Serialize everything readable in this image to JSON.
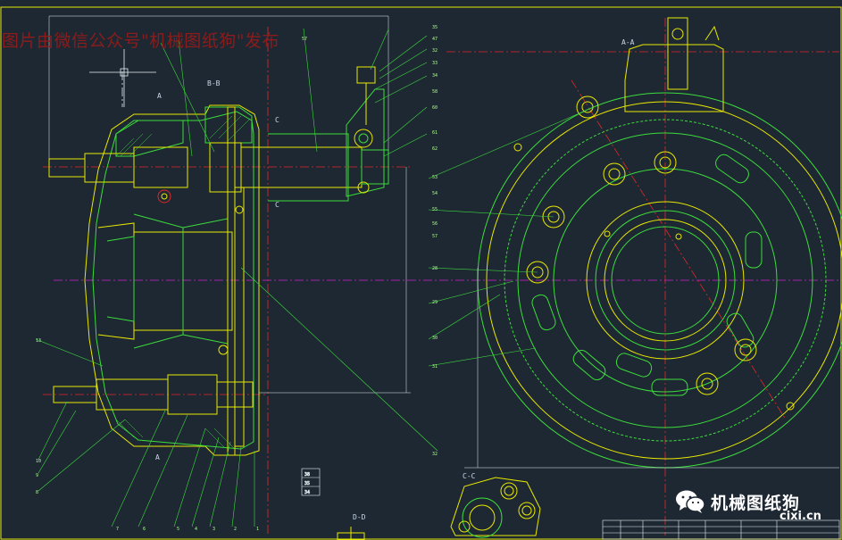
{
  "overlay": {
    "watermark": "图片由微信公众号\"机械图纸狗\"发布",
    "brand": "机械图纸狗",
    "site": "cixi.cn",
    "wechat_icon": "wechat-icon"
  },
  "views": {
    "bb": "B-B",
    "aa": "A-A",
    "cc": "C-C",
    "dd": "D-D",
    "section_a_top": "A",
    "section_a_bottom": "A",
    "section_c_top": "C",
    "section_c_bottom": "C"
  },
  "balloons_right_top": [
    "35",
    "47",
    "32",
    "33",
    "34",
    "58",
    "60",
    "61",
    "62"
  ],
  "balloons_left_top": [
    "57"
  ],
  "balloons_mid_right": [
    "53",
    "54",
    "55",
    "56",
    "57"
  ],
  "balloons_aa_left": [
    "28",
    "29",
    "30",
    "31",
    "32"
  ],
  "balloons_left": [
    "13",
    "10",
    "9",
    "8"
  ],
  "balloons_bottom": [
    "7",
    "6",
    "5",
    "4",
    "3",
    "2",
    "1"
  ],
  "balloons_small_table": [
    "38",
    "35",
    "34"
  ],
  "colors": {
    "background": "#1e2833",
    "yellow": "#e8e800",
    "green": "#3cdc3c",
    "red": "#e02828",
    "magenta": "#d020d0",
    "white": "#e8eef4",
    "cyan": "#40e0e0"
  }
}
